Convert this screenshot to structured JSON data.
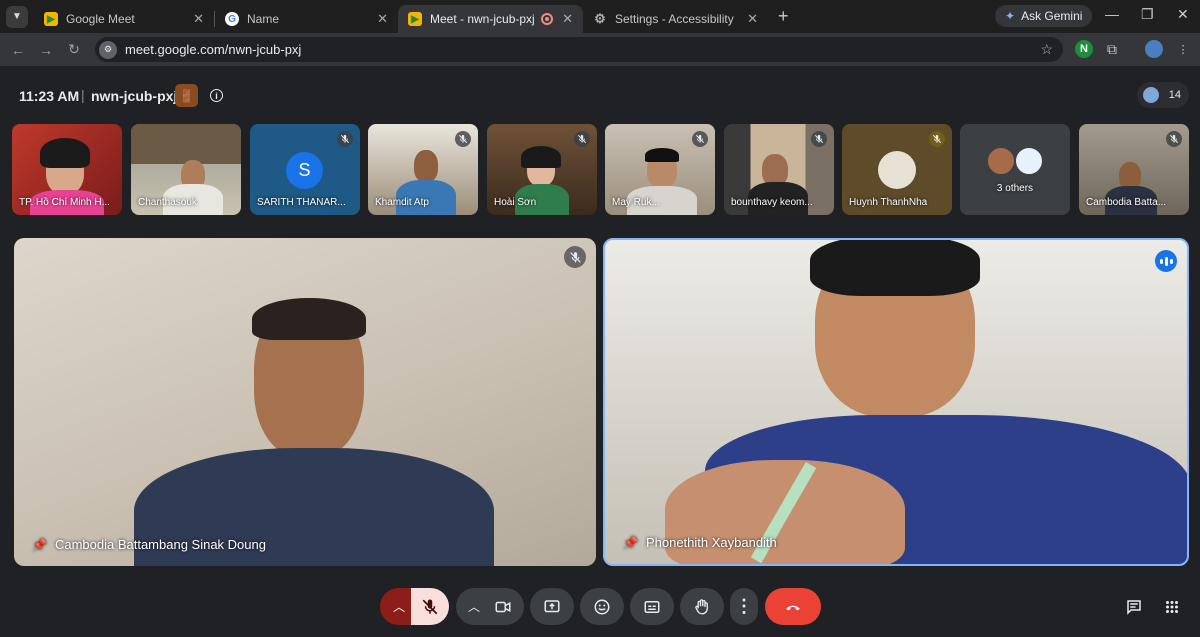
{
  "browser": {
    "tabs": [
      {
        "title": "Google Meet"
      },
      {
        "title": "Name"
      },
      {
        "title": "Meet - nwn-jcub-pxj"
      },
      {
        "title": "Settings - Accessibility"
      }
    ],
    "ask_gemini": "Ask Gemini",
    "url": "meet.google.com/nwn-jcub-pxj"
  },
  "meeting": {
    "time": "11:23 AM",
    "separator": "|",
    "code": "nwn-jcub-pxj",
    "participant_count": "14",
    "info_glyph": "i",
    "door_glyph": "🚪"
  },
  "filmstrip": [
    {
      "name": "TP. Hồ Chí Minh H..."
    },
    {
      "name": "Chanthasouk"
    },
    {
      "name": "SARITH THANAR...",
      "initial": "S"
    },
    {
      "name": "Khamdit Atp"
    },
    {
      "name": "Hoài Sơn"
    },
    {
      "name": "May Ruk..."
    },
    {
      "name": "bounthavy keom..."
    },
    {
      "name": "Huynh ThanhNha"
    },
    {
      "name": "3 others"
    },
    {
      "name": "Cambodia Batta..."
    }
  ],
  "main_tiles": [
    {
      "name": "Cambodia Battambang Sinak Doung"
    },
    {
      "name": "Phonethith Xaybandith"
    }
  ],
  "icons": {
    "tab_menu": "chevron-down-icon",
    "back": "arrow-left-icon",
    "forward": "arrow-right-icon",
    "reload": "reload-icon",
    "bookmark": "star-icon",
    "mic_off": "mic-off-icon",
    "hangup": "phone-hangup-icon"
  },
  "colors": {
    "accent_blue": "#8ab4f8",
    "hangup_red": "#ea4335",
    "mic_off_bg": "#f9dedc",
    "raise_bg": "#8c1d18"
  }
}
